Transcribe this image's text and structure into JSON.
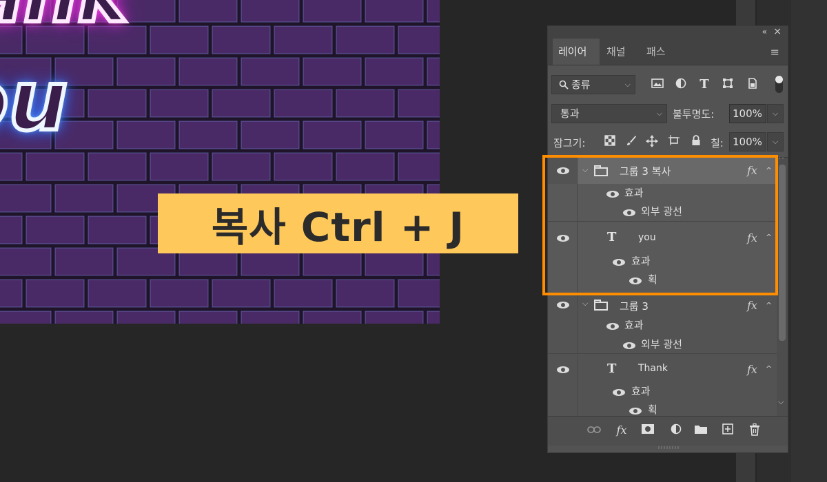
{
  "canvas": {
    "neon_line1": "ank",
    "neon_line2": "ou",
    "colors": {
      "wall": "#2d1a38",
      "brick": "#4a2a66",
      "mortar": "#8aa7ff",
      "pink_glow": "#ff34e3",
      "blue_glow": "#3d8cff"
    }
  },
  "caption": {
    "text": "복사 Ctrl + J",
    "bg": "#ffc85a"
  },
  "panel": {
    "collapse_icon": "«",
    "close_icon": "×",
    "menu_icon": "≡",
    "tabs": [
      {
        "label": "레이어",
        "active": true
      },
      {
        "label": "채널",
        "active": false
      },
      {
        "label": "패스",
        "active": false
      }
    ],
    "filter": {
      "search_icon": "search-icon",
      "label": "종류",
      "icons": [
        "image-filter-icon",
        "adjustment-filter-icon",
        "type-filter-icon",
        "shape-filter-icon",
        "smart-object-filter-icon"
      ]
    },
    "blend_mode": "통과",
    "opacity_label": "불투명도:",
    "opacity_value": "100%",
    "lock_label": "잠그기:",
    "lock_icons": [
      "lock-transparent-icon",
      "lock-paint-icon",
      "lock-position-icon",
      "lock-artboard-icon",
      "lock-all-icon"
    ],
    "fill_label": "칠:",
    "fill_value": "100%",
    "layers": [
      {
        "type": "group",
        "name": "그룹 3 복사",
        "fx": "fx",
        "selected": true,
        "effects_label": "효과",
        "effect": "외부 광선"
      },
      {
        "type": "text",
        "name": "you",
        "fx": "fx",
        "effects_label": "효과",
        "effect": "획"
      },
      {
        "type": "group",
        "name": "그룹 3",
        "fx": "fx",
        "effects_label": "효과",
        "effect": "외부 광선"
      },
      {
        "type": "text",
        "name": "Thank",
        "fx": "fx",
        "effects_label": "효과",
        "effect": "획"
      }
    ],
    "footer_icons": [
      "link-icon",
      "fx-icon",
      "mask-icon",
      "adjustment-layer-icon",
      "new-group-icon",
      "new-layer-icon",
      "trash-icon"
    ],
    "footer_fx": "fx",
    "highlight_color": "#ff8d00"
  }
}
